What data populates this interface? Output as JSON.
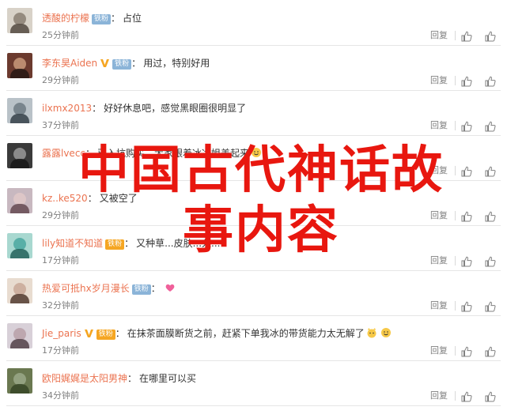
{
  "labels": {
    "reply": "回复"
  },
  "comments": [
    {
      "name": "透酸的柠檬",
      "verified": false,
      "badge": "铁粉",
      "badge_style": "fans",
      "text": "占位",
      "time": "25分钟前",
      "avatar_colors": [
        "#d8d2c8",
        "#8a7f72",
        "#5b5148"
      ]
    },
    {
      "name": "李东昊Aiden",
      "verified": true,
      "badge": "铁粉",
      "badge_style": "fans",
      "text": "用过，特别好用",
      "time": "29分钟前",
      "avatar_colors": [
        "#6b3a2e",
        "#c99a7a",
        "#2a1a15"
      ]
    },
    {
      "name": "ilxmx2013",
      "verified": false,
      "badge": "",
      "badge_style": "",
      "text": "好好休息吧，感觉黑眼圈很明显了",
      "time": "37分钟前",
      "avatar_colors": [
        "#b9c2c8",
        "#6d7a83",
        "#3d4850"
      ]
    },
    {
      "name": "露露lvecc",
      "verified": false,
      "badge": "",
      "badge_style": "",
      "text": "已入坑购买，大家跟着冰冰姐美起来",
      "time": "",
      "avatar_colors": [
        "#3a3a3a",
        "#9a9a9a",
        "#1a1a1a"
      ]
    },
    {
      "name": "kz..ke520",
      "verified": false,
      "badge": "",
      "badge_style": "",
      "text": "又被空了",
      "time": "29分钟前",
      "avatar_colors": [
        "#c8b8c0",
        "#e0c8c8",
        "#6a5058"
      ]
    },
    {
      "name": "lily知道不知道",
      "verified": false,
      "badge": "铁粉",
      "badge_style": "gold",
      "text": "又种草...皮肤...入...",
      "time": "17分钟前",
      "avatar_colors": [
        "#a8d8d0",
        "#4aa8a0",
        "#2a6860"
      ]
    },
    {
      "name": "热爱可抵hx岁月漫长",
      "verified": false,
      "badge": "铁粉",
      "badge_style": "fans",
      "text": "",
      "time": "32分钟前",
      "avatar_colors": [
        "#e8dcd0",
        "#c8a898",
        "#5a4438"
      ]
    },
    {
      "name": "Jie_paris",
      "verified": true,
      "badge": "铁粉",
      "badge_style": "gold",
      "text": "在抹茶面膜断货之前，赶紧下单我冰的带货能力太无解了",
      "time": "17分钟前",
      "avatar_colors": [
        "#d8d0d8",
        "#b8a0a8",
        "#5a4850"
      ]
    },
    {
      "name": "欧阳娓娓是太阳男神",
      "verified": false,
      "badge": "",
      "badge_style": "",
      "text": "在哪里可以买",
      "time": "34分钟前",
      "avatar_colors": [
        "#6a7850",
        "#9aa888",
        "#3a4828"
      ]
    }
  ],
  "overlay": {
    "line1": "中国古代神话故",
    "line2": "事内容"
  },
  "colors": {
    "name": "#eb7350",
    "overlay": "#e8170f",
    "muted": "#808080"
  }
}
